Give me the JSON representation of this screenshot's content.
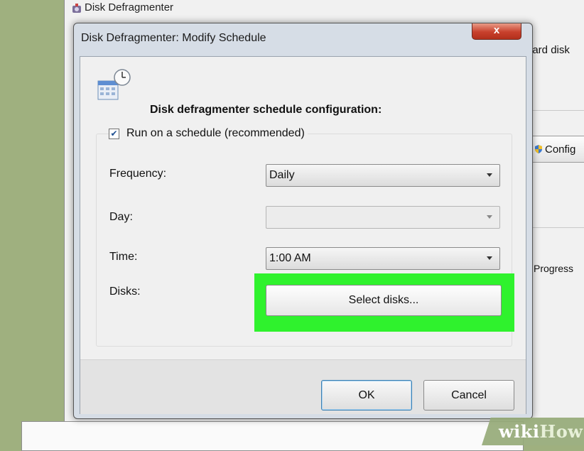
{
  "background_window": {
    "title": "Disk Defragmenter",
    "text_hard_disk": "hard disk",
    "configure_button_label": "Config",
    "progress_text": "Progress"
  },
  "dialog": {
    "title": "Disk Defragmenter: Modify Schedule",
    "close_label": "x",
    "heading": "Disk defragmenter schedule configuration:",
    "run_on_schedule": {
      "label": "Run on a schedule (recommended)",
      "checked": true,
      "check_glyph": "✔"
    },
    "fields": {
      "frequency": {
        "label": "Frequency:",
        "value": "Daily"
      },
      "day": {
        "label": "Day:",
        "value": ""
      },
      "time": {
        "label": "Time:",
        "value": "1:00 AM"
      },
      "disks": {
        "label": "Disks:",
        "button_label": "Select disks..."
      }
    },
    "buttons": {
      "ok": "OK",
      "cancel": "Cancel"
    }
  },
  "highlight_color": "#2ff22d",
  "watermark": {
    "wiki": "wiki",
    "how": "How"
  }
}
